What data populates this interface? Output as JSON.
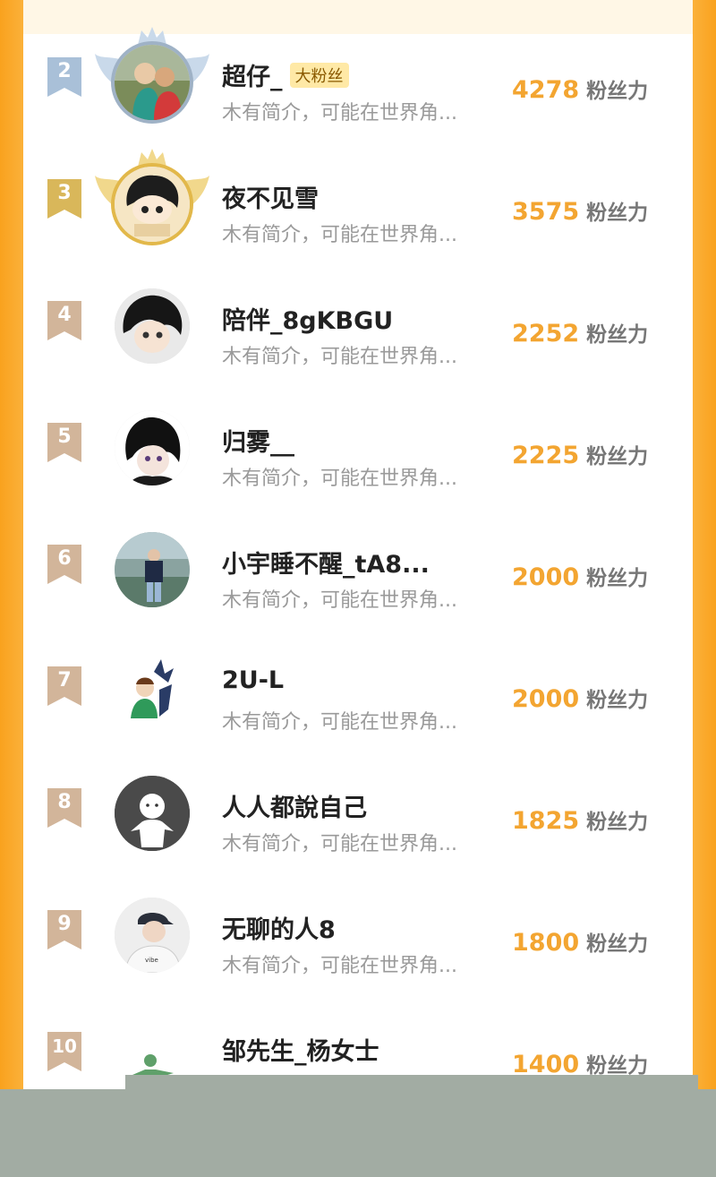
{
  "ranking": {
    "rows": [
      {
        "rank": "2",
        "name": "超仔_",
        "badge": "大粉丝",
        "desc": "木有简介，可能在世界角...",
        "score": "4278",
        "unit": "粉丝力",
        "avatar_icon": "avatar-couple-photo",
        "frame": "silver"
      },
      {
        "rank": "3",
        "name": "夜不见雪",
        "badge": "",
        "desc": "木有简介，可能在世界角...",
        "score": "3575",
        "unit": "粉丝力",
        "avatar_icon": "avatar-anime-boy",
        "frame": "gold"
      },
      {
        "rank": "4",
        "name": "陪伴_8gKBGU",
        "badge": "",
        "desc": "木有简介，可能在世界角...",
        "score": "2252",
        "unit": "粉丝力",
        "avatar_icon": "avatar-anime-boy"
      },
      {
        "rank": "5",
        "name": "归雾__",
        "badge": "",
        "desc": "木有简介，可能在世界角...",
        "score": "2225",
        "unit": "粉丝力",
        "avatar_icon": "avatar-anime-boy"
      },
      {
        "rank": "6",
        "name": "小宇睡不醒_tA8...",
        "badge": "",
        "desc": "木有简介，可能在世界角...",
        "score": "2000",
        "unit": "粉丝力",
        "avatar_icon": "avatar-person-photo"
      },
      {
        "rank": "7",
        "name": "2U-L",
        "badge": "",
        "desc": "木有简介，可能在世界角...",
        "score": "2000",
        "unit": "粉丝力",
        "avatar_icon": "avatar-cartoon"
      },
      {
        "rank": "8",
        "name": "人人都說自己",
        "badge": "",
        "desc": "木有简介，可能在世界角...",
        "score": "1825",
        "unit": "粉丝力",
        "avatar_icon": "avatar-default"
      },
      {
        "rank": "9",
        "name": "无聊的人8",
        "badge": "",
        "desc": "木有简介，可能在世界角...",
        "score": "1800",
        "unit": "粉丝力",
        "avatar_icon": "avatar-person-photo"
      },
      {
        "rank": "10",
        "name": "邹先生_杨女士",
        "badge": "",
        "desc": "",
        "score": "1400",
        "unit": "粉丝力",
        "avatar_icon": "avatar-cartoon"
      }
    ]
  },
  "colors": {
    "accent_orange": "#f9a21e",
    "score_orange": "#f3a531",
    "rank_silver": "#a9c0d8",
    "rank_gold": "#d9b75a",
    "rank_default": "#d2b59a"
  }
}
